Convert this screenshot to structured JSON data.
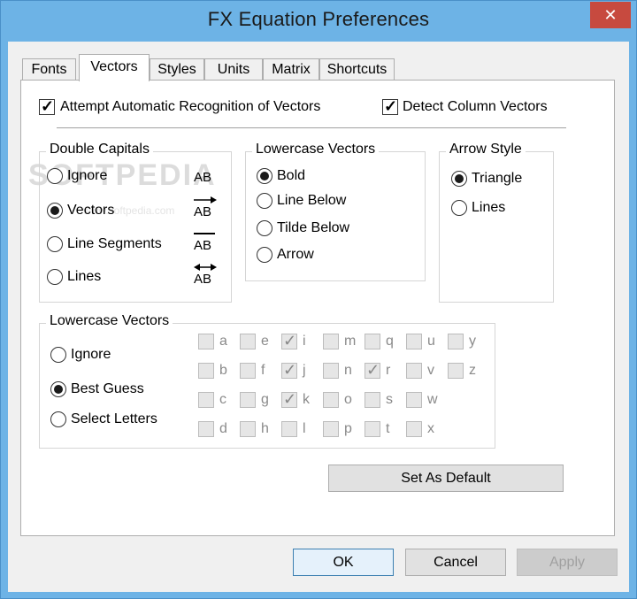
{
  "window": {
    "title": "FX Equation Preferences",
    "close_symbol": "✕"
  },
  "tabs": [
    {
      "label": "Fonts"
    },
    {
      "label": "Vectors"
    },
    {
      "label": "Styles"
    },
    {
      "label": "Units"
    },
    {
      "label": "Matrix"
    },
    {
      "label": "Shortcuts"
    }
  ],
  "active_tab": "Vectors",
  "top_options": {
    "auto_recognition": {
      "label": "Attempt Automatic Recognition of Vectors",
      "checked": true
    },
    "column_vectors": {
      "label": "Detect Column Vectors",
      "checked": true
    }
  },
  "double_capitals": {
    "title": "Double Capitals",
    "options": [
      {
        "label": "Ignore",
        "selected": false,
        "sample": "AB"
      },
      {
        "label": "Vectors",
        "selected": true,
        "sample": "AB"
      },
      {
        "label": "Line Segments",
        "selected": false,
        "sample": "AB"
      },
      {
        "label": "Lines",
        "selected": false,
        "sample": "AB"
      }
    ]
  },
  "lowercase_style": {
    "title": "Lowercase Vectors",
    "options": [
      {
        "label": "Bold",
        "selected": true
      },
      {
        "label": "Line Below",
        "selected": false
      },
      {
        "label": "Tilde Below",
        "selected": false
      },
      {
        "label": "Arrow",
        "selected": false
      }
    ]
  },
  "arrow_style": {
    "title": "Arrow Style",
    "options": [
      {
        "label": "Triangle",
        "selected": true
      },
      {
        "label": "Lines",
        "selected": false
      }
    ]
  },
  "lowercase_letters": {
    "title": "Lowercase Vectors",
    "options": [
      {
        "label": "Ignore",
        "selected": false
      },
      {
        "label": "Best Guess",
        "selected": true
      },
      {
        "label": "Select Letters",
        "selected": false
      }
    ],
    "letters": {
      "a": false,
      "b": false,
      "c": false,
      "d": false,
      "e": false,
      "f": false,
      "g": false,
      "h": false,
      "i": true,
      "j": true,
      "k": true,
      "l": false,
      "m": false,
      "n": false,
      "o": false,
      "p": false,
      "q": false,
      "r": true,
      "s": false,
      "t": false,
      "u": false,
      "v": false,
      "w": false,
      "x": false,
      "y": false,
      "z": false
    }
  },
  "buttons": {
    "set_default": "Set As Default",
    "ok": "OK",
    "cancel": "Cancel",
    "apply": "Apply"
  },
  "watermark": {
    "text": "SOFTPEDIA",
    "sub": "www.softpedia.com"
  },
  "icons": {
    "close": "close-icon",
    "checkmark": "checkmark-icon"
  },
  "colors": {
    "titlebar": "#6db3e6",
    "close": "#c74a3f",
    "default_button_border": "#3c7fb1"
  }
}
